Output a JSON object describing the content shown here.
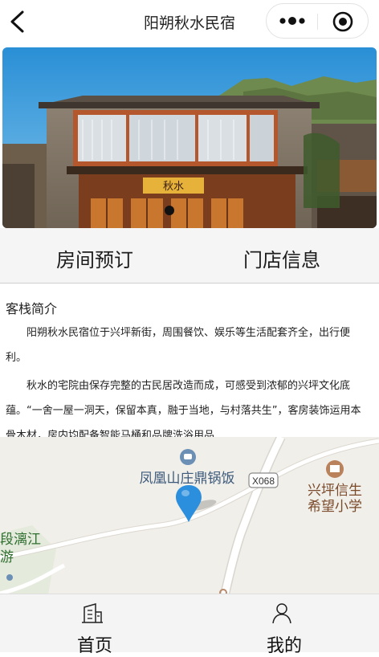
{
  "header": {
    "title": "阳朔秋水民宿",
    "back_icon": "chevron-left-icon",
    "more_icon": "more-dots-icon",
    "close_icon": "target-close-icon"
  },
  "banner": {
    "sign_text": "秋水",
    "carousel_dots": 1,
    "active_dot": 1
  },
  "tabs": [
    {
      "label": "房间预订"
    },
    {
      "label": "门店信息"
    }
  ],
  "intro": {
    "heading": "客栈简介",
    "paragraphs": [
      "阳朔秋水民宿位于兴坪新街，周围餐饮、娱乐等生活配套齐全，出行便利。",
      "秋水的宅院由保存完整的古民居改造而成，可感受到浓郁的兴坪文化底蕴。“一舍一屋一洞天，保留本真，融于当地，与村落共生”，客房装饰运用本骨木材，房内均配备智能马桶和品牌洗浴用品"
    ]
  },
  "map": {
    "poi_restaurant": "凤凰山庄鼎锅饭",
    "road_code": "X068",
    "poi_school_line1": "兴坪信生",
    "poi_school_line2": "希望小学",
    "poi_river_line1": "段漓江",
    "poi_river_line2": "游",
    "colors": {
      "background": "#f1efe9",
      "road": "#ffffff",
      "pin": "#2b8fde",
      "school": "#7a4a2b",
      "river_text": "#2f6f2f"
    }
  },
  "bottom_nav": [
    {
      "label": "首页",
      "icon": "home-building-icon"
    },
    {
      "label": "我的",
      "icon": "user-icon"
    }
  ]
}
